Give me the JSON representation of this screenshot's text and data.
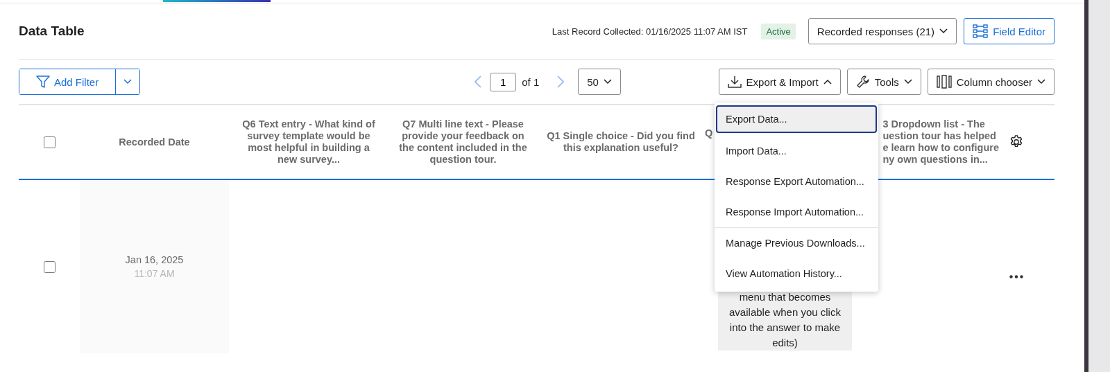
{
  "title": "Data Table",
  "last_record": "Last Record Collected: 01/16/2025 11:07 AM IST",
  "status_badge": "Active",
  "responses_select": "Recorded responses (21)",
  "field_editor_button": "Field Editor",
  "add_filter_button": "Add Filter",
  "pagination": {
    "page": "1",
    "of": "of 1",
    "page_size": "50"
  },
  "toolbar_buttons": [
    {
      "kind": "export",
      "label": "Export & Import",
      "expanded": true
    },
    {
      "kind": "tools",
      "label": "Tools",
      "expanded": false
    },
    {
      "kind": "columns",
      "label": "Column chooser",
      "expanded": false
    }
  ],
  "table": {
    "select_all_checked": false,
    "columns": [
      {
        "kind": "text",
        "label": "Recorded Date"
      },
      {
        "kind": "text",
        "label": "Q6 Text entry - What kind of survey template would be most helpful in building a new survey..."
      },
      {
        "kind": "text",
        "label": "Q7 Multi line text - Please provide your feedback on the content included in the question tour."
      },
      {
        "kind": "text",
        "label": "Q1 Single choice - Did you find this explanation useful?"
      },
      {
        "kind": "covered",
        "label": "Q"
      },
      {
        "kind": "covered-lines",
        "lines": [
          "3 Dropdown list - The",
          "uestion tour has helped",
          "e learn how to configure",
          "ny own questions in..."
        ]
      }
    ],
    "rows": [
      {
        "checked": false,
        "date": "Jan 16, 2025",
        "time": "11:07 AM",
        "covered_cell": "menu that becomes available when you click into the answer to make edits)"
      }
    ]
  },
  "menu": {
    "groups": [
      [
        {
          "label": "Export Data...",
          "selected": true
        },
        {
          "label": "Import Data...",
          "selected": false
        },
        {
          "label": "Response Export Automation...",
          "selected": false
        },
        {
          "label": "Response Import Automation...",
          "selected": false
        }
      ],
      [
        {
          "label": "Manage Previous Downloads...",
          "selected": false
        },
        {
          "label": "View Automation History...",
          "selected": false
        }
      ]
    ]
  }
}
